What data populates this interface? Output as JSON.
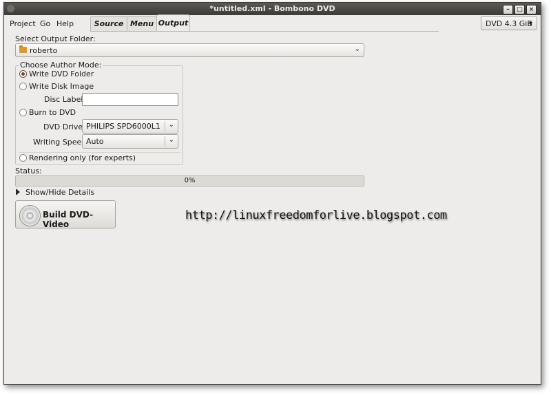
{
  "window": {
    "title": "*untitled.xml - Bombono DVD",
    "buttons": {
      "minimize": "–",
      "maximize": "□",
      "close": "×"
    }
  },
  "menu": {
    "items": [
      "Project",
      "Go",
      "Help"
    ]
  },
  "tabs": {
    "items": [
      "Source",
      "Menu",
      "Output"
    ],
    "active": "Output"
  },
  "disc_type": {
    "value": "DVD 4.3 GiB"
  },
  "output": {
    "folder_label": "Select Output Folder:",
    "folder_value": "roberto",
    "author_mode_title": "Choose Author Mode:",
    "modes": [
      "Write DVD Folder",
      "Write Disk Image",
      "Burn to DVD",
      "Rendering only (for experts)"
    ],
    "selected_mode": "Write DVD Folder",
    "disc_label_label": "Disc Label:",
    "disc_label_value": "",
    "dvd_drive_label": "DVD Drive:",
    "dvd_drive_value": "PHILIPS SPD6000L1",
    "writing_speed_label": "Writing Speed:",
    "writing_speed_value": "Auto"
  },
  "status": {
    "label": "Status:",
    "progress_text": "0%",
    "progress_fraction": 0.0,
    "details_toggle": "Show/Hide Details"
  },
  "build_button": {
    "label": "Build DVD-Video"
  },
  "watermark": {
    "text": "http://linuxfreedomforlive.blogspot.com"
  },
  "icons": {
    "folder": "folder-icon",
    "dvd": "dvd-disc-icon",
    "expander": "triangle-right-icon",
    "dropdown": "chevron-down-icon"
  }
}
